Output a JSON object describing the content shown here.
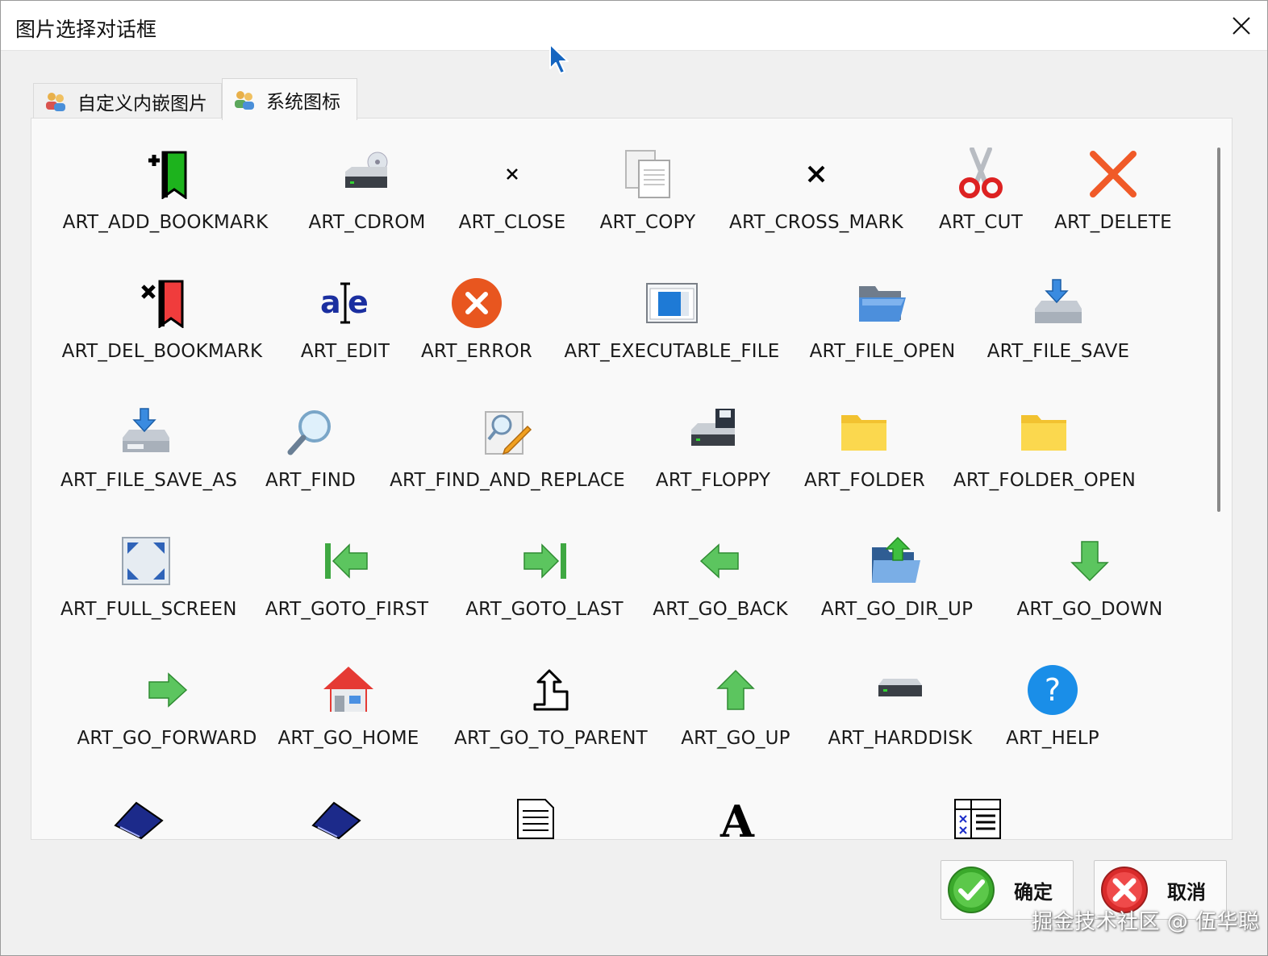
{
  "window": {
    "title": "图片选择对话框"
  },
  "tabs": [
    {
      "label": "自定义内嵌图片",
      "active": false
    },
    {
      "label": "系统图标",
      "active": true
    }
  ],
  "icons": [
    {
      "label": "ART_ADD_BOOKMARK",
      "icon": "add-bookmark-icon"
    },
    {
      "label": "ART_CDROM",
      "icon": "cdrom-icon"
    },
    {
      "label": "ART_CLOSE",
      "icon": "close-small-icon"
    },
    {
      "label": "ART_COPY",
      "icon": "copy-icon"
    },
    {
      "label": "ART_CROSS_MARK",
      "icon": "cross-mark-icon"
    },
    {
      "label": "ART_CUT",
      "icon": "scissors-icon"
    },
    {
      "label": "ART_DELETE",
      "icon": "delete-x-icon"
    },
    {
      "label": "ART_DEL_BOOKMARK",
      "icon": "del-bookmark-icon"
    },
    {
      "label": "ART_EDIT",
      "icon": "edit-text-icon"
    },
    {
      "label": "ART_ERROR",
      "icon": "error-icon"
    },
    {
      "label": "ART_EXECUTABLE_FILE",
      "icon": "executable-file-icon"
    },
    {
      "label": "ART_FILE_OPEN",
      "icon": "file-open-icon"
    },
    {
      "label": "ART_FILE_SAVE",
      "icon": "file-save-icon"
    },
    {
      "label": "ART_FILE_SAVE_AS",
      "icon": "file-save-as-icon"
    },
    {
      "label": "ART_FIND",
      "icon": "magnifier-icon"
    },
    {
      "label": "ART_FIND_AND_REPLACE",
      "icon": "find-replace-icon"
    },
    {
      "label": "ART_FLOPPY",
      "icon": "floppy-icon"
    },
    {
      "label": "ART_FOLDER",
      "icon": "folder-icon"
    },
    {
      "label": "ART_FOLDER_OPEN",
      "icon": "folder-open-icon"
    },
    {
      "label": "ART_FULL_SCREEN",
      "icon": "full-screen-icon"
    },
    {
      "label": "ART_GOTO_FIRST",
      "icon": "goto-first-icon"
    },
    {
      "label": "ART_GOTO_LAST",
      "icon": "goto-last-icon"
    },
    {
      "label": "ART_GO_BACK",
      "icon": "arrow-left-icon"
    },
    {
      "label": "ART_GO_DIR_UP",
      "icon": "dir-up-icon"
    },
    {
      "label": "ART_GO_DOWN",
      "icon": "arrow-down-icon"
    },
    {
      "label": "ART_GO_FORWARD",
      "icon": "arrow-right-icon"
    },
    {
      "label": "ART_GO_HOME",
      "icon": "home-icon"
    },
    {
      "label": "ART_GO_TO_PARENT",
      "icon": "go-to-parent-icon"
    },
    {
      "label": "ART_GO_UP",
      "icon": "arrow-up-icon"
    },
    {
      "label": "ART_HARDDISK",
      "icon": "harddisk-icon"
    },
    {
      "label": "ART_HELP",
      "icon": "help-icon"
    },
    {
      "label": "",
      "icon": "help-book-icon"
    },
    {
      "label": "",
      "icon": "help-book-icon"
    },
    {
      "label": "",
      "icon": "document-icon"
    },
    {
      "label": "",
      "icon": "font-icon"
    },
    {
      "label": "",
      "icon": "report-view-icon"
    }
  ],
  "buttons": {
    "ok_label": "确定",
    "cancel_label": "取消"
  },
  "watermark": "掘金技术社区 @ 伍华聪",
  "colors": {
    "accent": "#1e88e5",
    "ok_green": "#3aa92b",
    "cancel_red": "#e03434"
  }
}
